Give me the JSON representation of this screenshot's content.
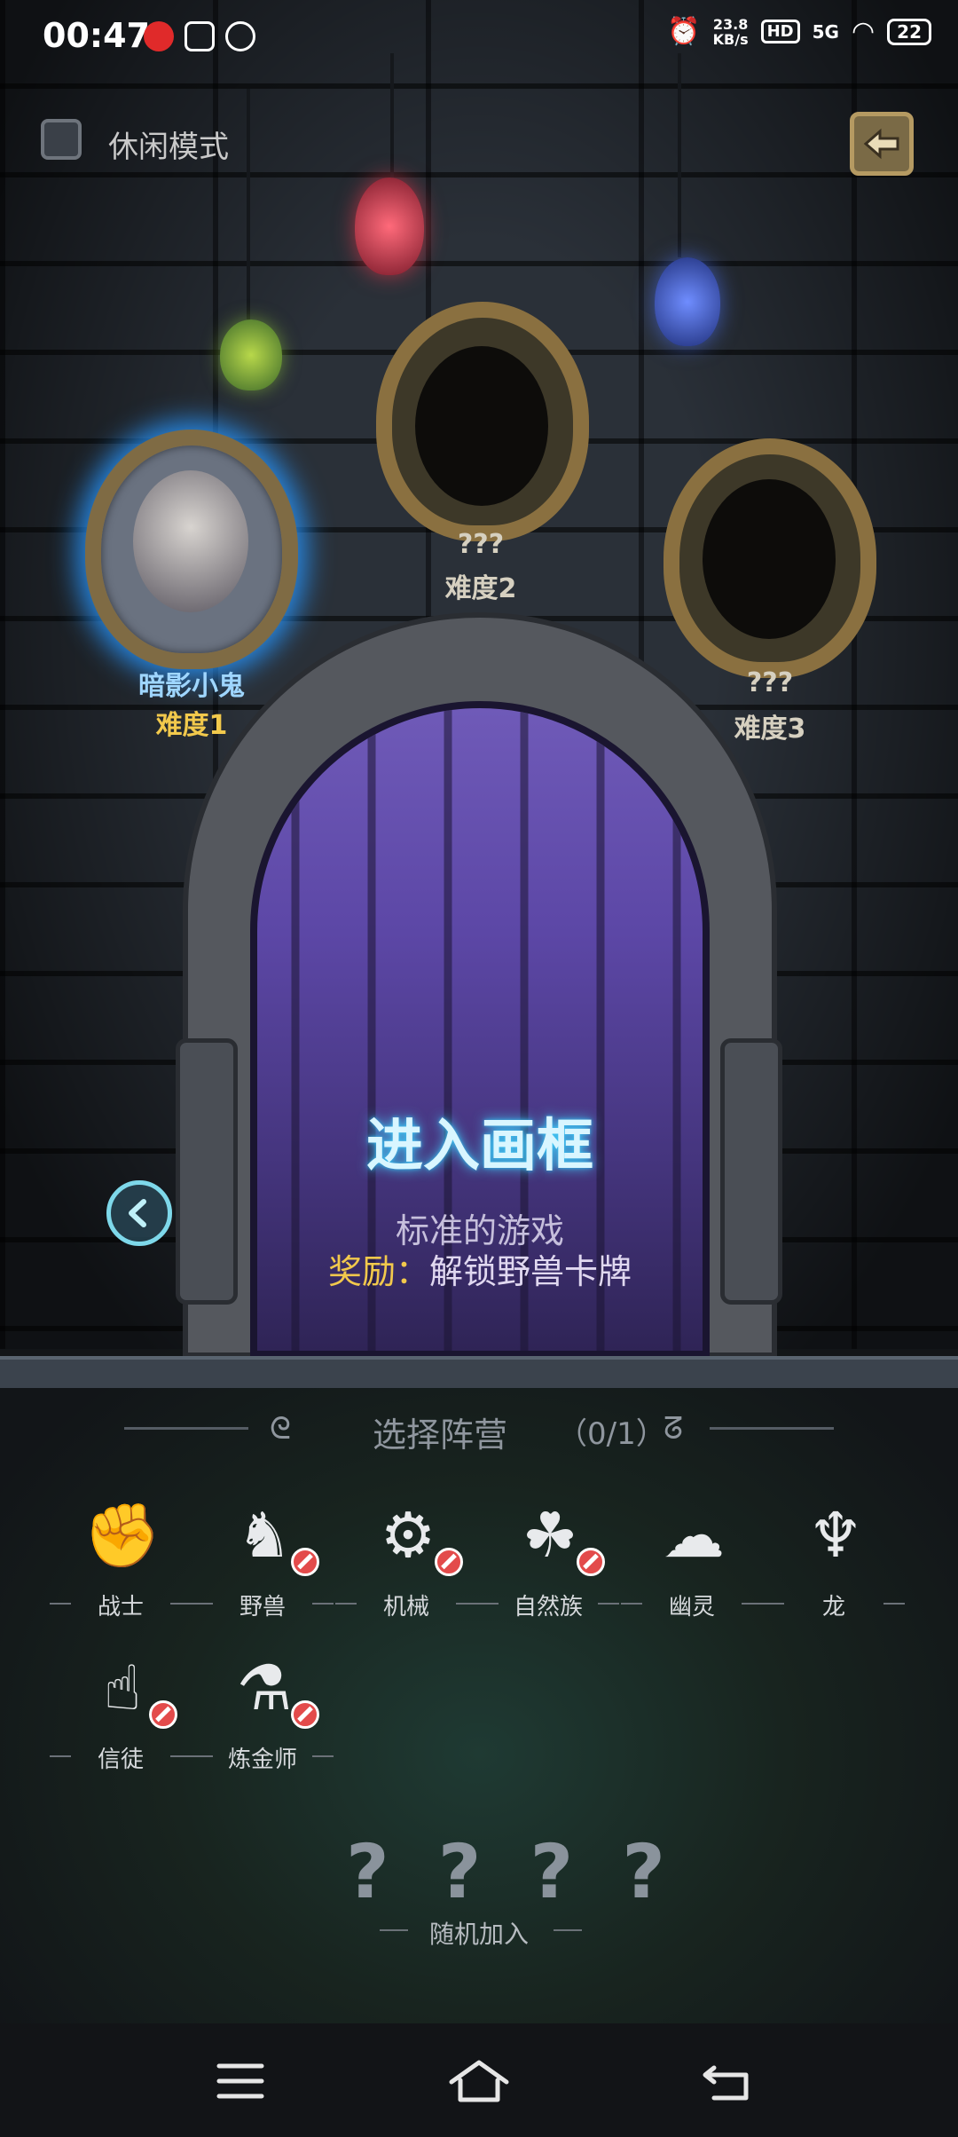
{
  "status_bar": {
    "time": "00:47",
    "net_speed_value": "23.8",
    "net_speed_unit": "KB/s",
    "hd_badge": "HD",
    "network": "5G",
    "battery": "22"
  },
  "casual_mode": {
    "label": "休闲模式",
    "checked": false
  },
  "difficulties": [
    {
      "name": "暗影小鬼",
      "difficulty": "难度1",
      "selected": true
    },
    {
      "name": "???",
      "difficulty": "难度2",
      "selected": false
    },
    {
      "name": "???",
      "difficulty": "难度3",
      "selected": false
    }
  ],
  "door": {
    "title": "进入画框",
    "description": "标准的游戏",
    "reward_label": "奖励：",
    "reward_text": "解锁野兽卡牌"
  },
  "faction_select": {
    "title": "选择阵营",
    "count": "（0/1）",
    "factions": [
      {
        "label": "战士",
        "icon": "fist-icon",
        "locked": false
      },
      {
        "label": "野兽",
        "icon": "beast-icon",
        "locked": true
      },
      {
        "label": "机械",
        "icon": "wrench-icon",
        "locked": true
      },
      {
        "label": "自然族",
        "icon": "nature-icon",
        "locked": true
      },
      {
        "label": "幽灵",
        "icon": "ghost-icon",
        "locked": false
      },
      {
        "label": "龙",
        "icon": "dragon-icon",
        "locked": false
      },
      {
        "label": "信徒",
        "icon": "praying-hands-icon",
        "locked": true
      },
      {
        "label": "炼金师",
        "icon": "cauldron-icon",
        "locked": true
      }
    ]
  },
  "random_join": {
    "marks": [
      "?",
      "?",
      "?",
      "?"
    ],
    "label": "随机加入"
  },
  "colors": {
    "accent_blue": "#43d4ff",
    "reward_gold": "#f2c94c",
    "lock_red": "#e34b4b",
    "frame_gold": "#8a7040"
  }
}
